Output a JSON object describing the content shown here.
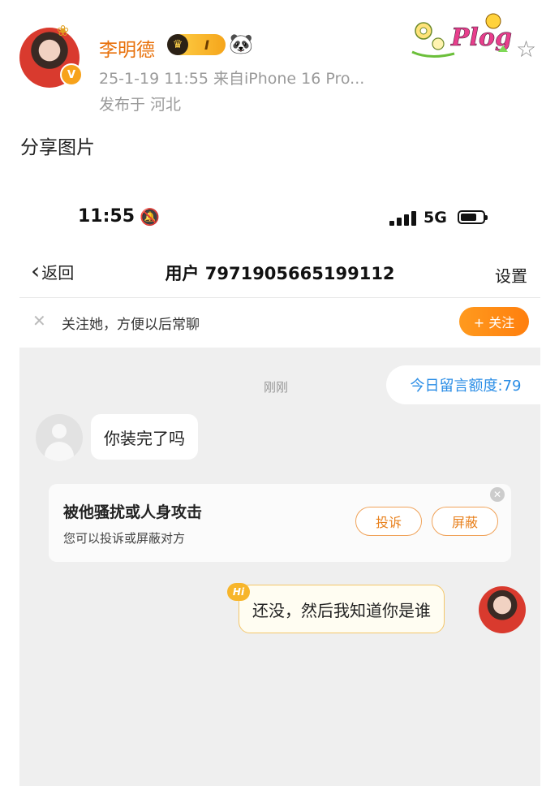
{
  "post": {
    "username": "李明德",
    "vip_level": "I",
    "meta": "25-1-19 11:55  来自iPhone 16 Pro...",
    "location": "发布于 河北",
    "text": "分享图片",
    "sticker_text": "Plog"
  },
  "screenshot": {
    "status": {
      "time": "11:55",
      "network": "5G"
    },
    "nav": {
      "back_label": "返回",
      "title": "用户 7971905665199112",
      "settings_label": "设置"
    },
    "follow_bar": {
      "tip": "关注她，方便以后常聊",
      "follow_label": "+ 关注"
    },
    "chat": {
      "quota": "今日留言额度:79",
      "time_label": "刚刚",
      "peer_message": "你装完了吗",
      "harass_card": {
        "title": "被他骚扰或人身攻击",
        "subtitle": "您可以投诉或屏蔽对方",
        "complain_label": "投诉",
        "block_label": "屏蔽"
      },
      "hi_badge": "Hi",
      "my_message": "还没，然后我知道你是谁"
    }
  },
  "colors": {
    "accent_orange": "#ff8a1a",
    "link_blue": "#2a8de6",
    "username_orange": "#e8710b"
  }
}
